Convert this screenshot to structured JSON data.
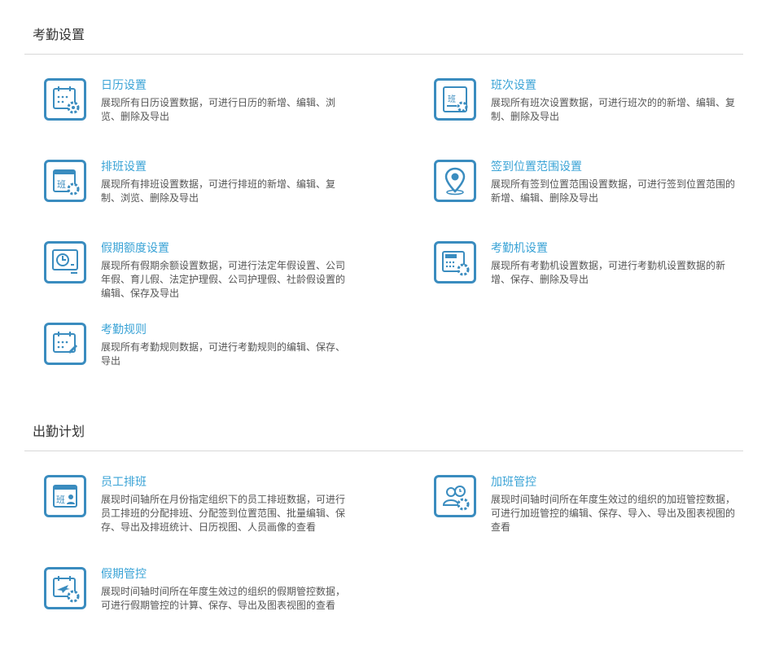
{
  "sections": [
    {
      "title": "考勤设置",
      "items": [
        {
          "title": "日历设置",
          "icon": "calendar-settings-icon",
          "desc": "展现所有日历设置数据，可进行日历的新增、编辑、浏览、删除及导出"
        },
        {
          "title": "班次设置",
          "icon": "shift-settings-icon",
          "desc": "展现所有班次设置数据，可进行班次的的新增、编辑、复制、删除及导出"
        },
        {
          "title": "排班设置",
          "icon": "schedule-settings-icon",
          "desc": "展现所有排班设置数据，可进行排班的新增、编辑、复制、浏览、删除及导出"
        },
        {
          "title": "签到位置范围设置",
          "icon": "location-pin-icon",
          "desc": "展现所有签到位置范围设置数据，可进行签到位置范围的新增、编辑、删除及导出"
        },
        {
          "title": "假期额度设置",
          "icon": "leave-quota-icon",
          "desc": "展现所有假期余额设置数据，可进行法定年假设置、公司年假、育儿假、法定护理假、公司护理假、社龄假设置的编辑、保存及导出"
        },
        {
          "title": "考勤机设置",
          "icon": "attendance-machine-icon",
          "desc": "展现所有考勤机设置数据，可进行考勤机设置数据的新增、保存、删除及导出"
        },
        {
          "title": "考勤规则",
          "icon": "attendance-rules-icon",
          "desc": "展现所有考勤规则数据，可进行考勤规则的编辑、保存、导出"
        }
      ]
    },
    {
      "title": "出勤计划",
      "items": [
        {
          "title": "员工排班",
          "icon": "employee-schedule-icon",
          "desc": "展现时间轴所在月份指定组织下的员工排班数据，可进行员工排班的分配排班、分配签到位置范围、批量编辑、保存、导出及排班统计、日历视图、人员画像的查看"
        },
        {
          "title": "加班管控",
          "icon": "overtime-control-icon",
          "desc": "展现时间轴时间所在年度生效过的组织的加班管控数据，可进行加班管控的编辑、保存、导入、导出及图表视图的查看"
        },
        {
          "title": "假期管控",
          "icon": "leave-control-icon",
          "desc": "展现时间轴时间所在年度生效过的组织的假期管控数据，可进行假期管控的计算、保存、导出及图表视图的查看"
        }
      ]
    }
  ]
}
